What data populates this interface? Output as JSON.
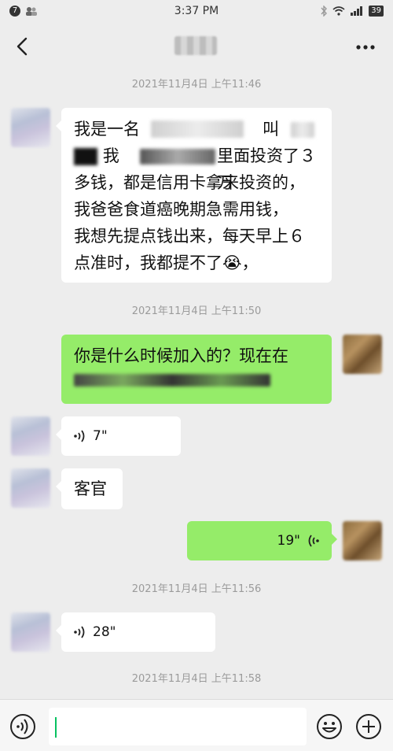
{
  "status_bar": {
    "notification_count": "7",
    "time": "3:37 PM",
    "battery": "39"
  },
  "header": {
    "back_icon": "chevron-left-icon",
    "more_icon": "more-dots-icon"
  },
  "timestamps": [
    "2021年11月4日 上午11:46",
    "2021年11月4日 上午11:50",
    "2021年11月4日 上午11:56",
    "2021年11月4日 上午11:58"
  ],
  "messages": [
    {
      "side": "in",
      "type": "text",
      "lines": [
        "我是一名",
        "叫",
        "我",
        "里面投资了３万",
        "多钱，都是信用卡拿来投资的，",
        "我爸爸食道癌晚期急需用钱，",
        "我想先提点钱出来，每天早上６",
        "点准时，我都提不了",
        "，"
      ]
    },
    {
      "side": "out",
      "type": "text",
      "lines": [
        "你是什么时候加入的？现在在"
      ]
    },
    {
      "side": "in",
      "type": "voice",
      "duration": "7\""
    },
    {
      "side": "in",
      "type": "text",
      "lines": [
        "客官"
      ]
    },
    {
      "side": "out",
      "type": "voice",
      "duration": "19\""
    },
    {
      "side": "in",
      "type": "voice",
      "duration": "28\""
    }
  ],
  "emoji": "😭",
  "input_bar": {
    "voice_icon": "voice-toggle-icon",
    "emoji_icon": "emoji-icon",
    "plus_icon": "plus-circle-icon",
    "value": ""
  },
  "colors": {
    "background": "#ededed",
    "incoming_bubble": "#ffffff",
    "outgoing_bubble": "#95ec69",
    "timestamp": "#9b9b9b",
    "caret": "#07c160"
  }
}
